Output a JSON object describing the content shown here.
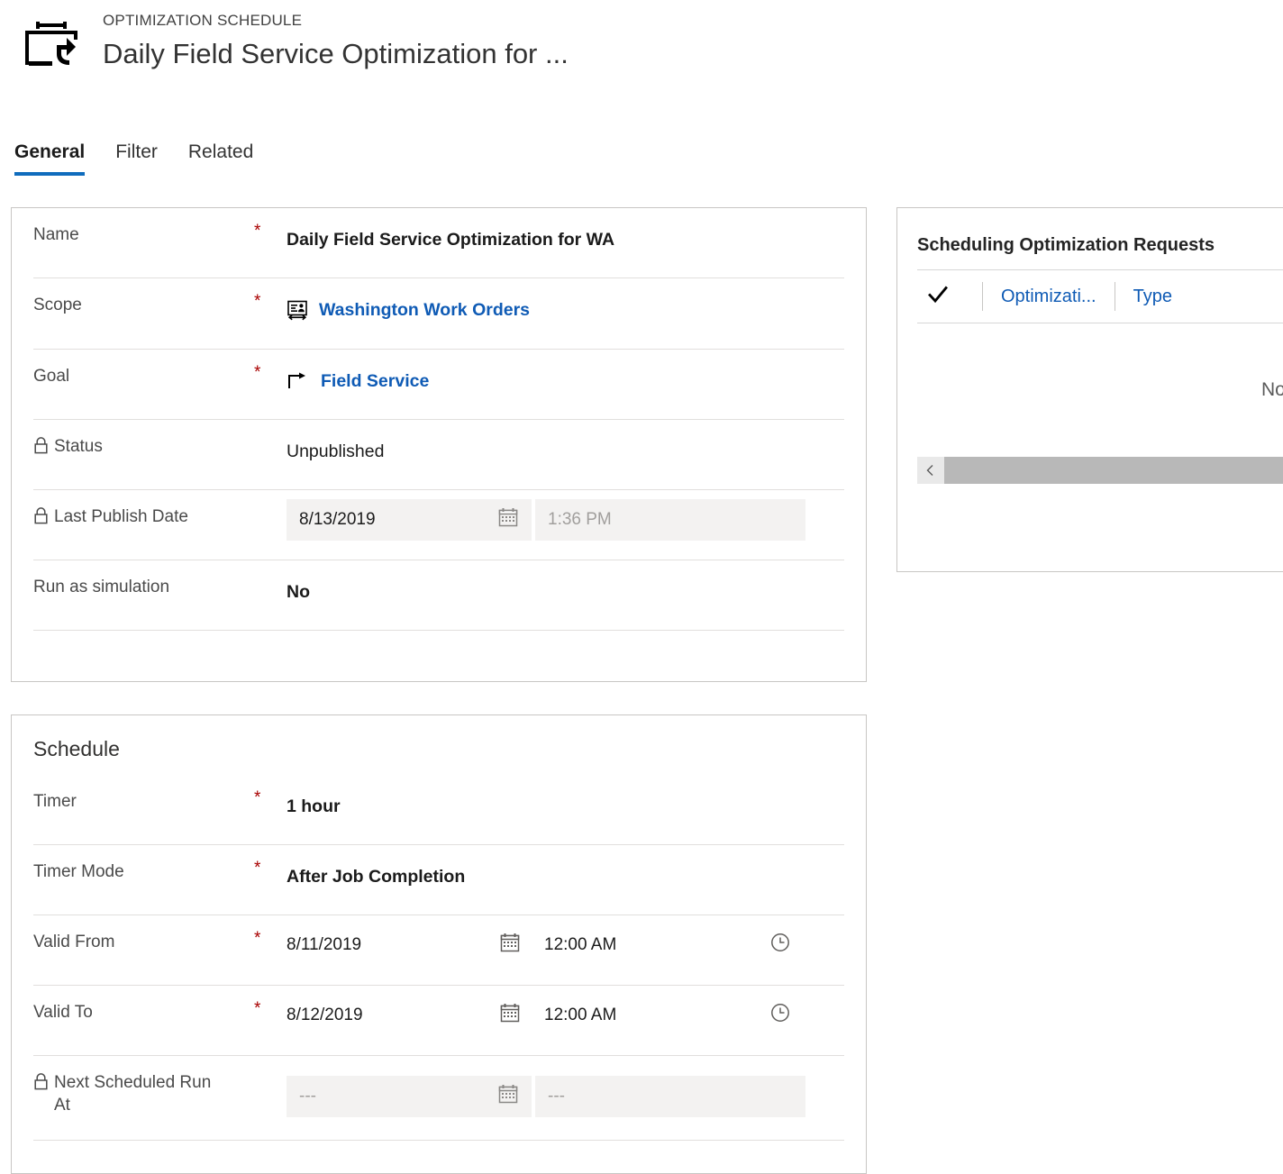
{
  "header": {
    "entity_type": "OPTIMIZATION SCHEDULE",
    "record_title": "Daily Field Service Optimization for ...",
    "icon": "optimization-schedule-icon"
  },
  "tabs": [
    {
      "label": "General",
      "active": true
    },
    {
      "label": "Filter",
      "active": false
    },
    {
      "label": "Related",
      "active": false
    }
  ],
  "general": {
    "fields": [
      {
        "label": "Name",
        "required": "*",
        "value": "Daily Field Service Optimization for WA",
        "locked": false,
        "kind": "text"
      },
      {
        "label": "Scope",
        "required": "*",
        "value": "Washington Work Orders",
        "locked": false,
        "kind": "lookup",
        "icon": "scope-territory-icon"
      },
      {
        "label": "Goal",
        "required": "*",
        "value": "Field Service",
        "locked": false,
        "kind": "lookup",
        "icon": "goal-arrow-icon"
      },
      {
        "label": "Status",
        "required": "",
        "value": "Unpublished",
        "locked": true,
        "kind": "text"
      },
      {
        "label": "Last Publish Date",
        "required": "",
        "locked": true,
        "kind": "datetime-readonly",
        "date_value": "8/13/2019",
        "time_value": "1:36 PM"
      },
      {
        "label": "Run as simulation",
        "required": "",
        "value": "No",
        "locked": false,
        "kind": "text"
      }
    ]
  },
  "schedule": {
    "title": "Schedule",
    "fields": [
      {
        "label": "Timer",
        "required": "*",
        "value": "1 hour",
        "locked": false,
        "kind": "text"
      },
      {
        "label": "Timer Mode",
        "required": "*",
        "value": "After Job Completion",
        "locked": false,
        "kind": "text"
      },
      {
        "label": "Valid From",
        "required": "*",
        "locked": false,
        "kind": "datetime",
        "date_value": "8/11/2019",
        "time_value": "12:00 AM"
      },
      {
        "label": "Valid To",
        "required": "*",
        "locked": false,
        "kind": "datetime",
        "date_value": "8/12/2019",
        "time_value": "12:00 AM"
      },
      {
        "label": "Next Scheduled Run At",
        "required": "",
        "locked": true,
        "kind": "datetime-readonly",
        "date_value": "---",
        "time_value": "---"
      }
    ]
  },
  "requests_panel": {
    "title": "Scheduling Optimization Requests",
    "columns": [
      {
        "label": "Optimizati...",
        "name": "optimization-request-column"
      },
      {
        "label": "Type",
        "name": "type-column"
      }
    ],
    "select_all_icon": "checkmark-icon",
    "empty_message": "No da",
    "scroll_left_icon": "chevron-left-icon"
  },
  "colors": {
    "accent_blue": "#1268d1",
    "link_blue": "#0f5bb5",
    "required_red": "#a80000",
    "card_border": "#c8c6c4",
    "row_divider": "#e1dfdd",
    "readonly_bg": "#f3f2f1",
    "scrollbar_thumb": "#b8b8b8"
  }
}
